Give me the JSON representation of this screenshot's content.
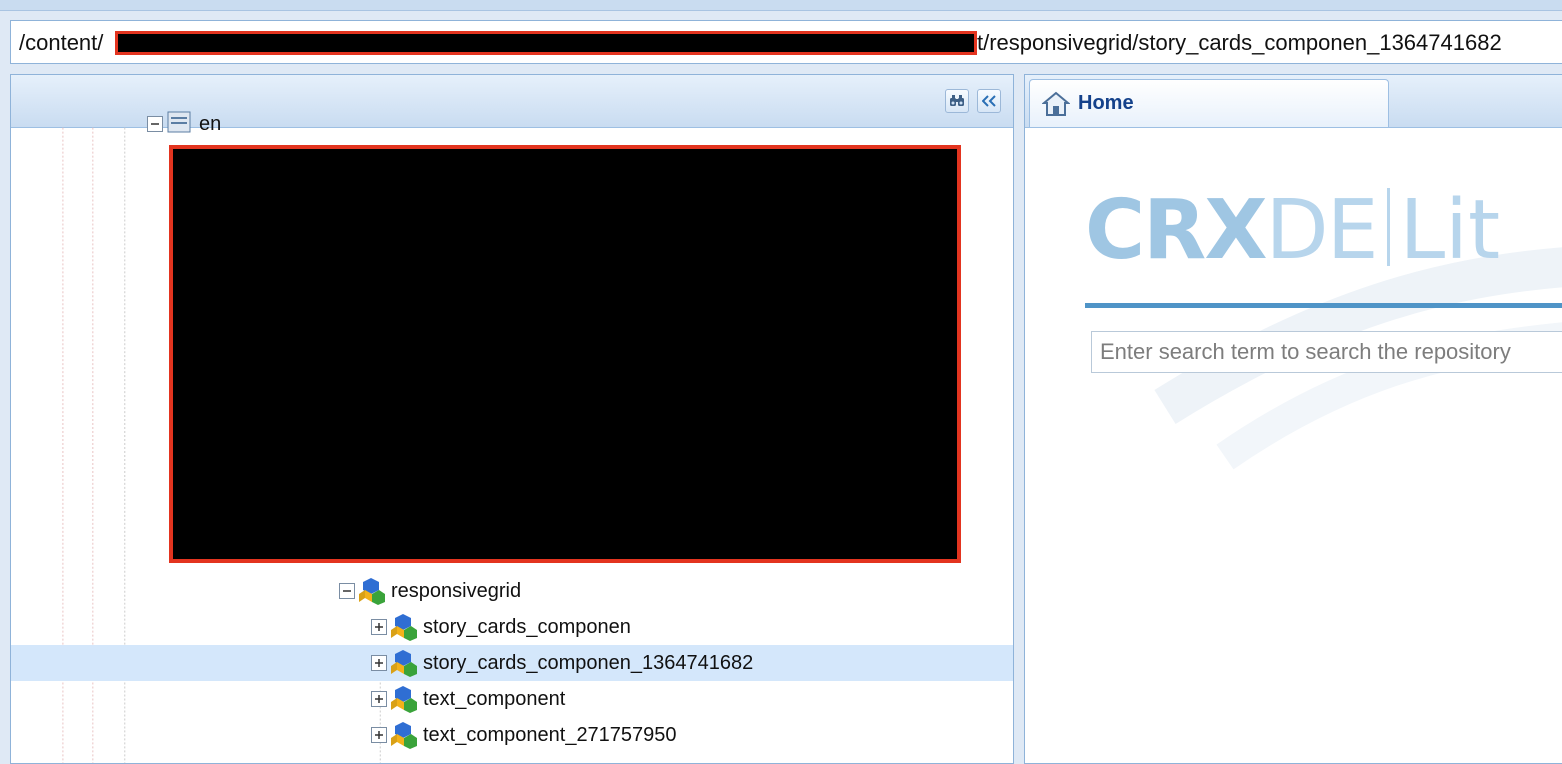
{
  "path_bar": {
    "prefix": "/content/",
    "suffix": "t/responsivegrid/story_cards_componen_1364741682"
  },
  "tree": {
    "partial_top_label": "en",
    "nodes": [
      {
        "label": "responsivegrid",
        "expanded": true,
        "selected": false
      },
      {
        "label": "story_cards_componen",
        "expanded": false,
        "selected": false
      },
      {
        "label": "story_cards_componen_1364741682",
        "expanded": false,
        "selected": true
      },
      {
        "label": "text_component",
        "expanded": false,
        "selected": false
      },
      {
        "label": "text_component_271757950",
        "expanded": false,
        "selected": false
      }
    ]
  },
  "right_panel": {
    "tab_label": "Home",
    "logo_primary": "CRX",
    "logo_secondary": "DE",
    "logo_tertiary": "Lit",
    "search_placeholder": "Enter search term to search the repository"
  },
  "colors": {
    "accent": "#4f94c7",
    "redaction_border": "#e3341f",
    "selection": "#d4e7fb"
  },
  "icons": {
    "find": "binoculars-icon",
    "collapse": "double-chevron-left-icon",
    "home": "home-icon",
    "node": "component-node-icon"
  }
}
